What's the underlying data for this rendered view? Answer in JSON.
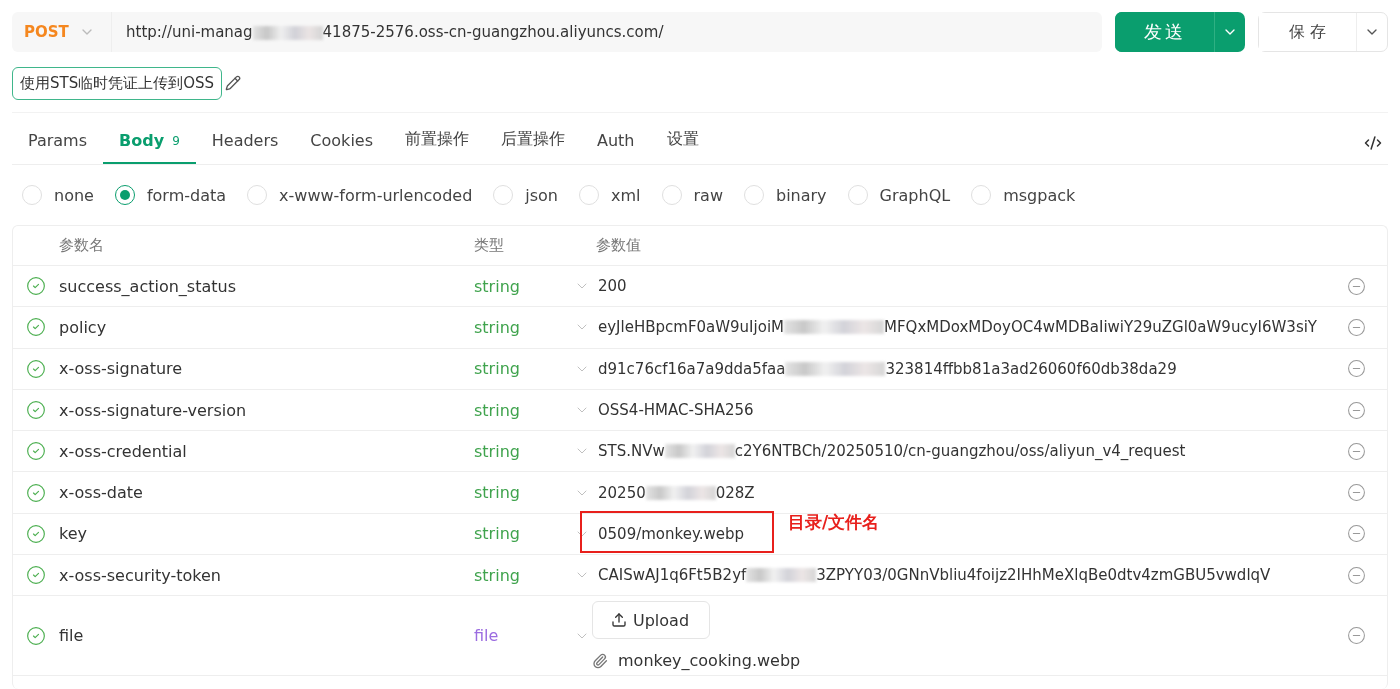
{
  "request": {
    "method": "POST",
    "url_parts": [
      "http://uni-manag",
      "41875-2576.oss-cn-guangzhou.aliyuncs.com/"
    ],
    "send_label": "发送",
    "save_label": "保 存"
  },
  "name_tag": "使用STS临时凭证上传到OSS",
  "tabs": [
    {
      "label": "Params",
      "selected": false
    },
    {
      "label": "Body",
      "badge": "9",
      "selected": true
    },
    {
      "label": "Headers",
      "selected": false
    },
    {
      "label": "Cookies",
      "selected": false
    },
    {
      "label": "前置操作",
      "selected": false
    },
    {
      "label": "后置操作",
      "selected": false
    },
    {
      "label": "Auth",
      "selected": false
    },
    {
      "label": "设置",
      "selected": false
    }
  ],
  "body_types": [
    {
      "label": "none",
      "selected": false
    },
    {
      "label": "form-data",
      "selected": true
    },
    {
      "label": "x-www-form-urlencoded",
      "selected": false
    },
    {
      "label": "json",
      "selected": false
    },
    {
      "label": "xml",
      "selected": false
    },
    {
      "label": "raw",
      "selected": false
    },
    {
      "label": "binary",
      "selected": false
    },
    {
      "label": "GraphQL",
      "selected": false
    },
    {
      "label": "msgpack",
      "selected": false
    }
  ],
  "table": {
    "columns": [
      "参数名",
      "类型",
      "参数值"
    ],
    "rows": [
      {
        "name": "success_action_status",
        "type": "string",
        "kind": "text",
        "value_parts": [
          "200"
        ],
        "checked": true
      },
      {
        "name": "policy",
        "type": "string",
        "kind": "text",
        "value_parts": [
          "eyJleHBpcmF0aW9uIjoiM",
          "MFQxMDoxMDoyOC4wMDBaIiwiY29uZGl0aW9ucyI6W3siY"
        ],
        "checked": true
      },
      {
        "name": "x-oss-signature",
        "type": "string",
        "kind": "text",
        "value_parts": [
          "d91c76cf16a7a9dda5faa",
          "323814ffbb81a3ad26060f60db38da29"
        ],
        "checked": true
      },
      {
        "name": "x-oss-signature-version",
        "type": "string",
        "kind": "text",
        "value_parts": [
          "OSS4-HMAC-SHA256"
        ],
        "checked": true
      },
      {
        "name": "x-oss-credential",
        "type": "string",
        "kind": "text",
        "value_parts": [
          "STS.NVw",
          "c2Y6NTBCh/20250510/cn-guangzhou/oss/aliyun_v4_request"
        ],
        "checked": true
      },
      {
        "name": "x-oss-date",
        "type": "string",
        "kind": "text",
        "value_parts": [
          "20250",
          "028Z"
        ],
        "checked": true
      },
      {
        "name": "key",
        "type": "string",
        "kind": "text",
        "value_parts": [
          "0509/monkey.webp"
        ],
        "checked": true,
        "annotation": "目录/文件名"
      },
      {
        "name": "x-oss-security-token",
        "type": "string",
        "kind": "text",
        "value_parts": [
          "CAISwAJ1q6Ft5B2yf",
          "3ZPYY03/0GNnVbliu4foijz2IHhMeXlqBe0dtv4zmGBU5vwdlqV"
        ],
        "checked": true
      },
      {
        "name": "file",
        "type": "file",
        "kind": "file",
        "upload_label": "Upload",
        "file_name": "monkey_cooking.webp",
        "checked": true
      }
    ]
  }
}
